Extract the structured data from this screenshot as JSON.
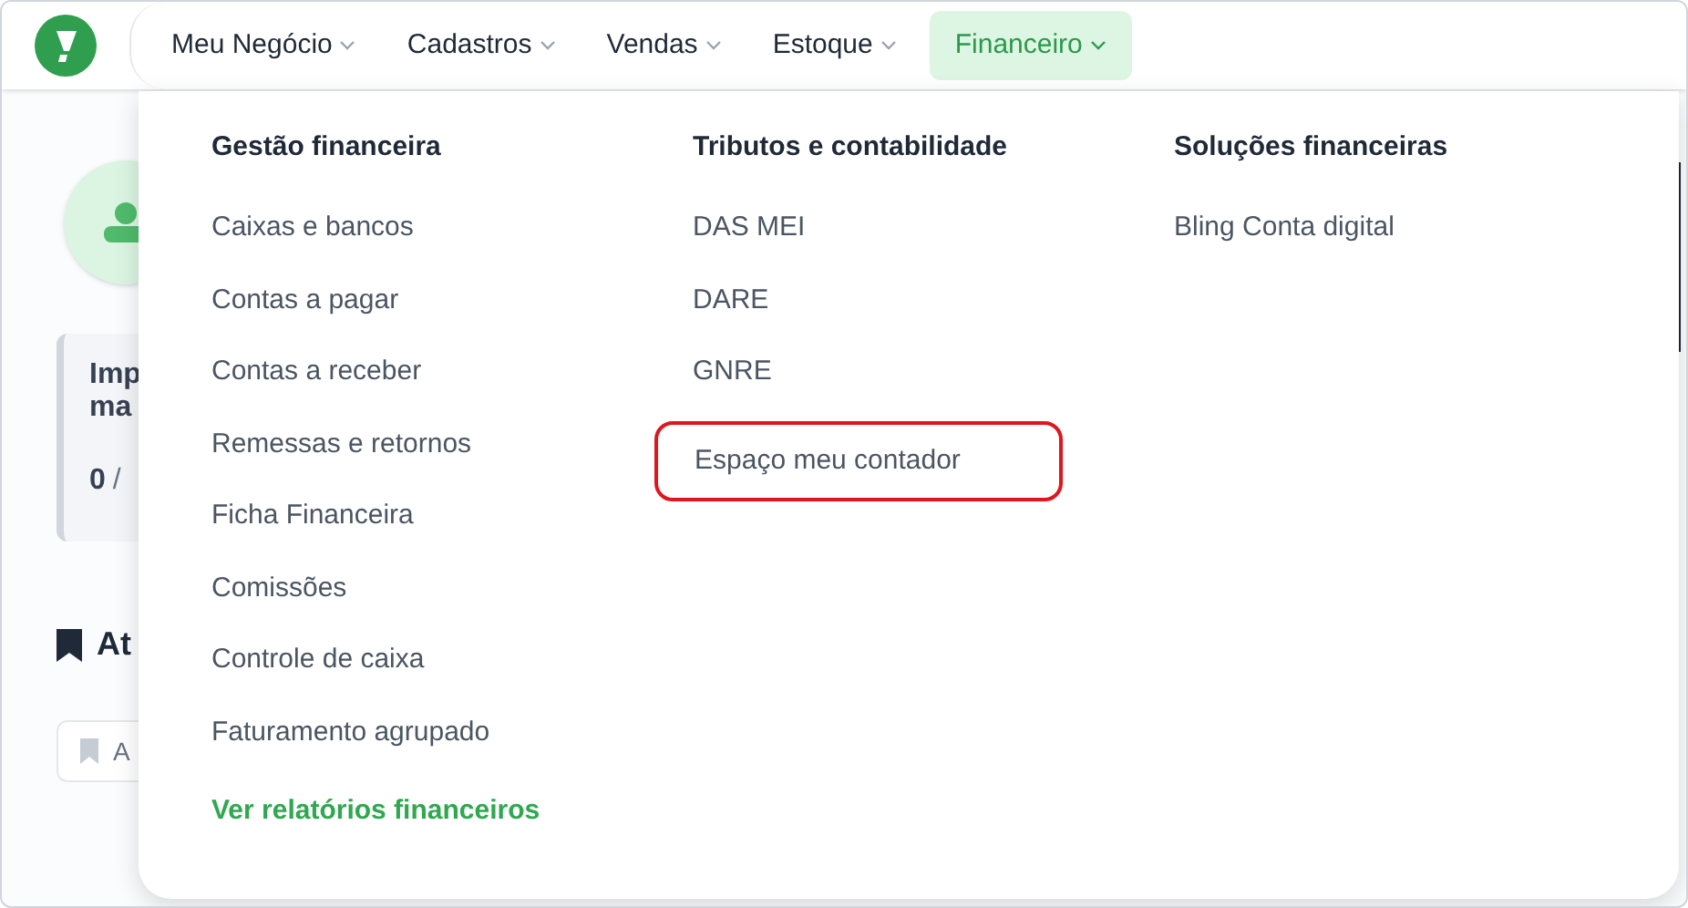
{
  "nav": {
    "items": [
      {
        "label": "Meu Negócio",
        "selected": false
      },
      {
        "label": "Cadastros",
        "selected": false
      },
      {
        "label": "Vendas",
        "selected": false
      },
      {
        "label": "Estoque",
        "selected": false
      },
      {
        "label": "Financeiro",
        "selected": true
      }
    ]
  },
  "background": {
    "card_title_lines": [
      "Imp",
      "ma"
    ],
    "card_count": "0",
    "card_separator": "/",
    "section_title": "At",
    "chip_label": "A"
  },
  "menu": {
    "columns": [
      {
        "heading": "Gestão financeira",
        "items": [
          {
            "label": "Caixas e bancos",
            "highlighted": false
          },
          {
            "label": "Contas a pagar",
            "highlighted": false
          },
          {
            "label": "Contas a receber",
            "highlighted": false
          },
          {
            "label": "Remessas e retornos",
            "highlighted": false
          },
          {
            "label": "Ficha Financeira",
            "highlighted": false
          },
          {
            "label": "Comissões",
            "highlighted": false
          },
          {
            "label": "Controle de caixa",
            "highlighted": false
          },
          {
            "label": "Faturamento agrupado",
            "highlighted": false
          }
        ],
        "footer_link": "Ver relatórios financeiros"
      },
      {
        "heading": "Tributos e contabilidade",
        "items": [
          {
            "label": "DAS MEI",
            "highlighted": false
          },
          {
            "label": "DARE",
            "highlighted": false
          },
          {
            "label": "GNRE",
            "highlighted": false
          },
          {
            "label": "Espaço meu contador",
            "highlighted": true
          }
        ]
      },
      {
        "heading": "Soluções financeiras",
        "items": [
          {
            "label": "Bling Conta digital",
            "highlighted": false
          }
        ]
      }
    ]
  }
}
